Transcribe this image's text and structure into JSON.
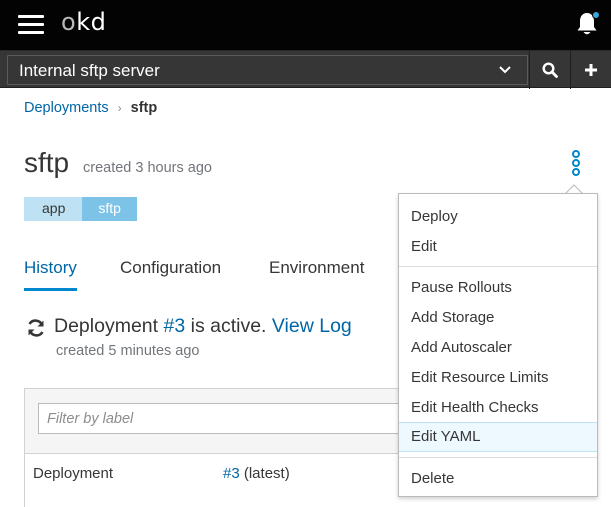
{
  "masthead": {
    "brand_prefix": "o",
    "brand_suffix": "kd",
    "notifications_icon": "bell-icon"
  },
  "projectbar": {
    "project_name": "Internal sftp server",
    "dropdown_icon": "chevron-down-icon",
    "search_icon": "search-icon",
    "add_icon": "plus-icon"
  },
  "breadcrumb": {
    "parent": "Deployments",
    "separator": "›",
    "current": "sftp"
  },
  "header": {
    "title": "sftp",
    "meta": "created 3 hours ago",
    "actions_icon": "kebab-icon"
  },
  "labels": [
    {
      "key": "app",
      "value": "sftp"
    }
  ],
  "tabs": [
    {
      "label": "History",
      "active": true
    },
    {
      "label": "Configuration",
      "active": false
    },
    {
      "label": "Environment",
      "active": false
    }
  ],
  "status": {
    "icon": "sync-icon",
    "prefix": "Deployment",
    "deployment_link": "#3",
    "middle": "is active.",
    "view_log": "View Log",
    "created": "created 5 minutes ago"
  },
  "table": {
    "filter_placeholder": "Filter by label",
    "row": {
      "label": "Deployment",
      "link": "#3",
      "suffix": "(latest)"
    }
  },
  "menu": {
    "items": [
      {
        "label": "Deploy"
      },
      {
        "label": "Edit"
      },
      {
        "label": "Pause Rollouts"
      },
      {
        "label": "Add Storage"
      },
      {
        "label": "Add Autoscaler"
      },
      {
        "label": "Edit Resource Limits"
      },
      {
        "label": "Edit Health Checks"
      },
      {
        "label": "Edit YAML",
        "hovered": true
      },
      {
        "label": "Delete"
      }
    ]
  },
  "colors": {
    "masthead": "#030303",
    "projectbar": "#363636",
    "link": "#0066a5",
    "accent": "#0088ce",
    "label_key_bg": "#bee1f4",
    "label_value_bg": "#7dc3e8",
    "menu_hover": "#edf8ff"
  }
}
